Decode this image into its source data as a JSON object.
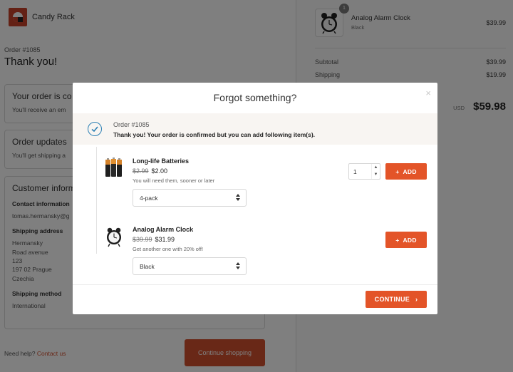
{
  "brand": {
    "name": "Candy Rack",
    "accent": "#e35428"
  },
  "page": {
    "order_number": "Order #1085",
    "thanks": "Thank you!",
    "confirmed_card": {
      "title": "Your order is co",
      "text": "You'll receive an em"
    },
    "updates_card": {
      "title": "Order updates",
      "text": "You'll get shipping a"
    },
    "customer_card": {
      "title": "Customer inform",
      "contact_label": "Contact information",
      "contact_value": "tomas.hermansky@g",
      "shipping_address_label": "Shipping address",
      "address_lines": [
        "Hermansky",
        "Road avenue",
        "123",
        "197 02 Prague",
        "Czechia"
      ],
      "shipping_method_label": "Shipping method",
      "shipping_method_value": "International"
    },
    "help_text": "Need help?",
    "help_link": "Contact us",
    "continue_shopping": "Continue shopping"
  },
  "summary": {
    "item": {
      "badge": "1",
      "name": "Analog Alarm Clock",
      "variant": "Black",
      "price": "$39.99"
    },
    "subtotal_label": "Subtotal",
    "subtotal_value": "$39.99",
    "shipping_label": "Shipping",
    "shipping_value": "$19.99",
    "currency": "USD",
    "total": "$59.98"
  },
  "modal": {
    "title": "Forgot something?",
    "close_icon": "×",
    "order_number": "Order #1085",
    "message": "Thank you! Your order is confirmed but you can add following item(s).",
    "items": [
      {
        "name": "Long-life Batteries",
        "old_price": "$2.99",
        "price": "$2.00",
        "description": "You will need them, sooner or later",
        "option": "4-pack",
        "quantity": "1",
        "add_label": "ADD",
        "icon": "batteries-icon"
      },
      {
        "name": "Analog Alarm Clock",
        "old_price": "$39.99",
        "price": "$31.99",
        "description": "Get another one with 20% off!",
        "option": "Black",
        "add_label": "ADD",
        "icon": "alarm-clock-icon"
      }
    ],
    "continue_label": "CONTINUE"
  }
}
